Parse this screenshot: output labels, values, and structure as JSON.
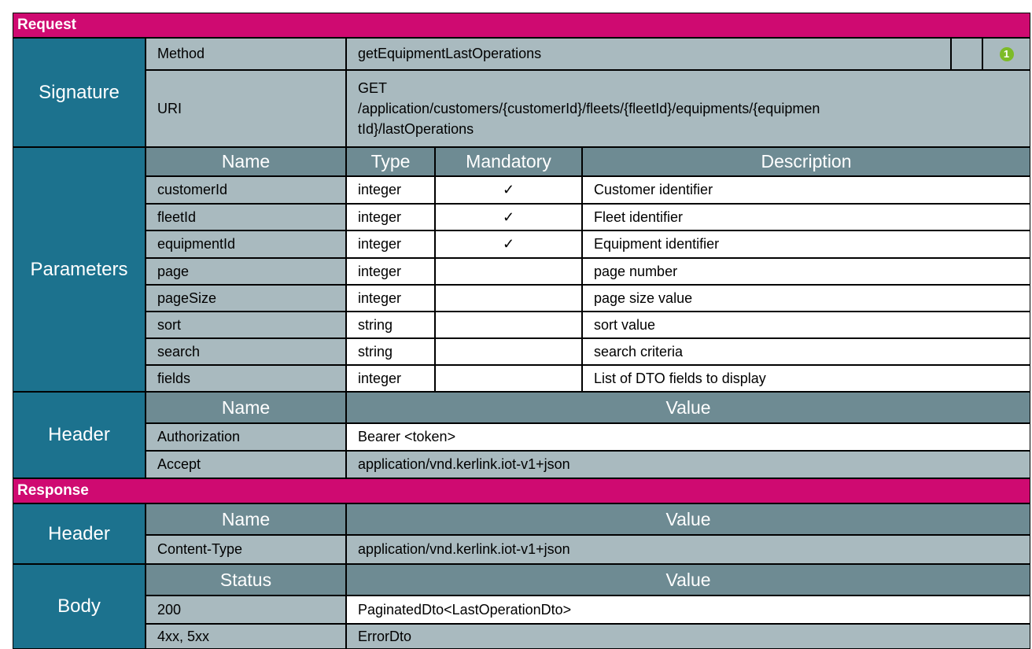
{
  "colors": {
    "section_header": "#cf0a71",
    "row_label": "#1c728e",
    "column_header": "#6e8b93",
    "name_cell": "#a9babf",
    "value_cell": "#ffffff",
    "note_badge": "#7dbb28"
  },
  "request": {
    "title": "Request",
    "signature": {
      "label": "Signature",
      "method_label": "Method",
      "method_value": "getEquipmentLastOperations",
      "note_number": "1",
      "note_icon": "numbered-note-icon",
      "uri_label": "URI",
      "uri_lines": [
        "GET",
        "/application/customers/{customerId}/fleets/{fleetId}/equipments/{equipmen",
        "tId}/lastOperations"
      ]
    },
    "parameters": {
      "label": "Parameters",
      "columns": [
        "Name",
        "Type",
        "Mandatory",
        "Description"
      ],
      "rows": [
        {
          "name": "customerId",
          "type": "integer",
          "mandatory": "✓",
          "description": "Customer identifier"
        },
        {
          "name": "fleetId",
          "type": "integer",
          "mandatory": "✓",
          "description": "Fleet identifier"
        },
        {
          "name": "equipmentId",
          "type": "integer",
          "mandatory": "✓",
          "description": "Equipment identifier"
        },
        {
          "name": "page",
          "type": "integer",
          "mandatory": "",
          "description": "page number"
        },
        {
          "name": "pageSize",
          "type": "integer",
          "mandatory": "",
          "description": "page size value"
        },
        {
          "name": "sort",
          "type": "string",
          "mandatory": "",
          "description": "sort value"
        },
        {
          "name": "search",
          "type": "string",
          "mandatory": "",
          "description": "search criteria"
        },
        {
          "name": "fields",
          "type": "integer",
          "mandatory": "",
          "description": "List of DTO fields to display"
        }
      ]
    },
    "header": {
      "label": "Header",
      "columns": [
        "Name",
        "Value"
      ],
      "rows": [
        {
          "name": "Authorization",
          "value": "Bearer <token>"
        },
        {
          "name": "Accept",
          "value": "application/vnd.kerlink.iot-v1+json"
        }
      ]
    }
  },
  "response": {
    "title": "Response",
    "header": {
      "label": "Header",
      "columns": [
        "Name",
        "Value"
      ],
      "rows": [
        {
          "name": "Content-Type",
          "value": "application/vnd.kerlink.iot-v1+json"
        }
      ]
    },
    "body": {
      "label": "Body",
      "columns": [
        "Status",
        "Value"
      ],
      "rows": [
        {
          "status": "200",
          "value": "PaginatedDto<LastOperationDto>"
        },
        {
          "status": "4xx, 5xx",
          "value": "ErrorDto"
        }
      ]
    }
  }
}
